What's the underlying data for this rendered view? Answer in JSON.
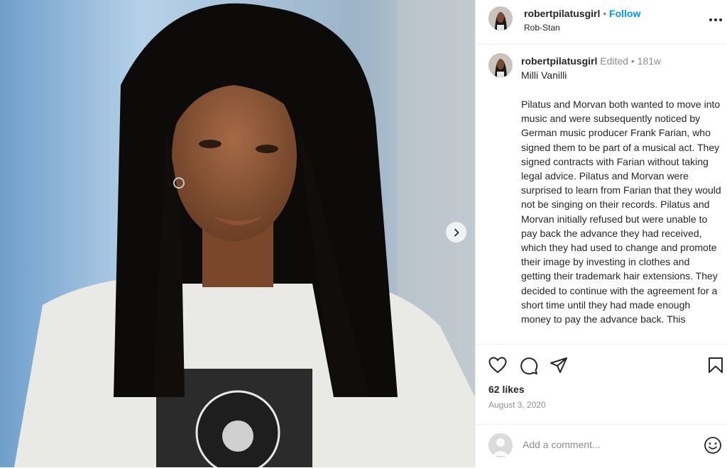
{
  "post": {
    "image_alt": "Photo of man with long dreadlocks",
    "next_icon": "chevron-right-icon"
  },
  "header": {
    "username": "robertpilatusgirl",
    "separator": "•",
    "follow_label": "Follow",
    "location": "Rob-Stan",
    "more_icon": "more-horizontal-icon"
  },
  "caption": {
    "username": "robertpilatusgirl",
    "edited": "Edited",
    "separator": "•",
    "age": "181w",
    "title": "Milli Vanilli",
    "body": "Pilatus and Morvan both wanted to move into music and were subsequently noticed by German music producer Frank Farian, who signed them to be part of a musical act. They signed contracts with Farian without taking legal advice. Pilatus and Morvan were surprised to learn from Farian that they would not be singing on their records. Pilatus and Morvan initially refused but were unable to pay back the advance they had received, which they had used to change and promote their image by investing in clothes and getting their trademark hair extensions. They decided to continue with the agreement for a short time until they had made enough money to pay the advance back. This"
  },
  "actions": {
    "like_icon": "heart-icon",
    "comment_icon": "comment-icon",
    "share_icon": "send-icon",
    "save_icon": "bookmark-icon"
  },
  "stats": {
    "likes": "62 likes",
    "date": "August 3, 2020"
  },
  "comment": {
    "placeholder": "Add a comment...",
    "emoji_icon": "smiley-icon"
  },
  "colors": {
    "accent": "#0095f6",
    "muted": "#8e8e8e",
    "text": "#262626"
  }
}
